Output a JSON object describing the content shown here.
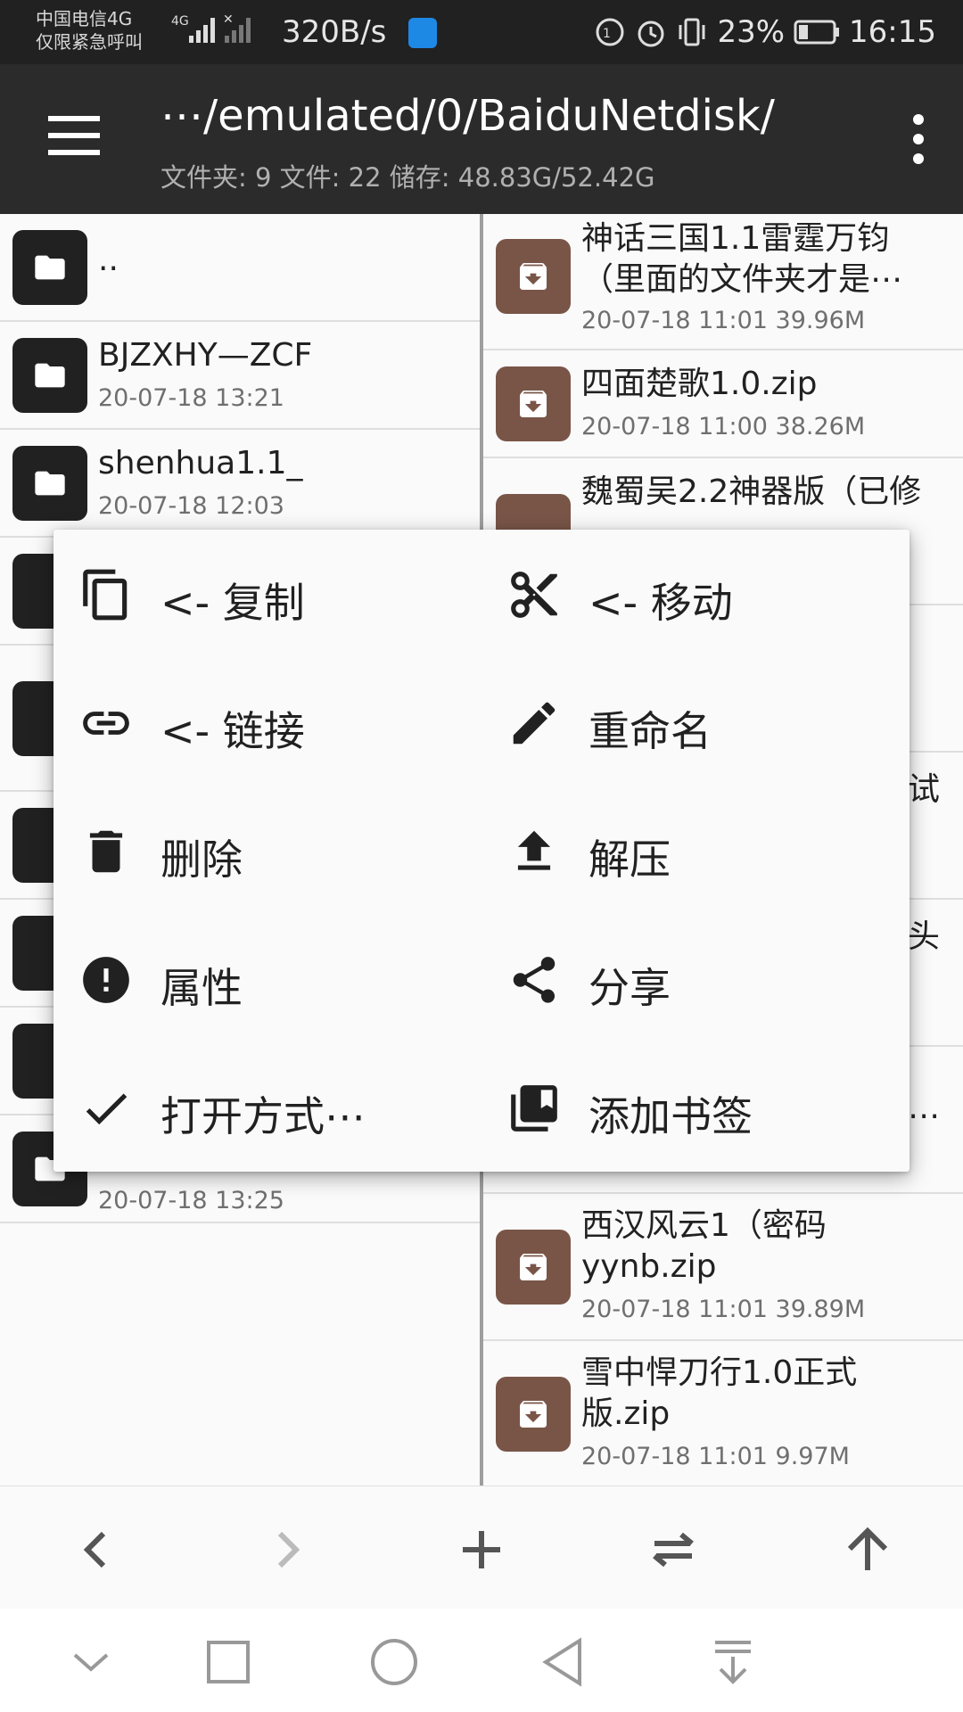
{
  "status": {
    "carrier_line1": "中国电信4G",
    "carrier_line2": "仅限紧急呼叫",
    "net_label": "4G",
    "speed": "320B/s",
    "battery": "23%",
    "time": "16:15"
  },
  "appbar": {
    "path": "⋯/emulated/0/BaiduNetdisk/",
    "stats": "文件夹: 9  文件: 22  储存: 48.83G/52.42G"
  },
  "left_pane": {
    "items": [
      {
        "name": "..",
        "meta": ""
      },
      {
        "name": "BJZXHY—ZCF",
        "meta": "20-07-18 13:21"
      },
      {
        "name": "shenhua1.1_",
        "meta": "20-07-18 12:03"
      },
      {
        "name": "",
        "meta": "20-07-18 13:25"
      }
    ]
  },
  "right_pane": {
    "items": [
      {
        "name1": "神话三国1.1雷霆万钧",
        "name2": "（里面的文件夹才是⋯",
        "meta": "20-07-18 11:01  39.96M"
      },
      {
        "name1": "四面楚歌1.0.zip",
        "meta": "20-07-18 11:00  38.26M"
      },
      {
        "name1": "魏蜀吴2.2神器版（已修"
      },
      {
        "fragment": "试"
      },
      {
        "fragment": "头"
      },
      {
        "fragment": "⋯"
      },
      {
        "name1": "西汉风云1（密码",
        "name2": "yynb.zip",
        "meta": "20-07-18 11:01  39.89M"
      },
      {
        "name1": "雪中悍刀行1.0正式",
        "name2": "版.zip",
        "meta": "20-07-18 11:01  9.97M"
      }
    ]
  },
  "context_menu": {
    "copy": "<- 复制",
    "move": "<- 移动",
    "link": "<- 链接",
    "rename": "重命名",
    "delete": "删除",
    "extract": "解压",
    "properties": "属性",
    "share": "分享",
    "open_with": "打开方式⋯",
    "bookmark": "添加书签"
  },
  "icons": [
    "menu-icon",
    "more-vert-icon",
    "folder-icon",
    "archive-icon",
    "copy-icon",
    "cut-icon",
    "link-icon",
    "edit-icon",
    "delete-icon",
    "upload-icon",
    "info-icon",
    "share-icon",
    "check-icon",
    "bookmark-icon",
    "back-icon",
    "forward-icon",
    "add-icon",
    "swap-icon",
    "up-icon"
  ],
  "colors": {
    "appbar": "#2b2b2b",
    "archive": "#795548",
    "folder": "#212121"
  }
}
